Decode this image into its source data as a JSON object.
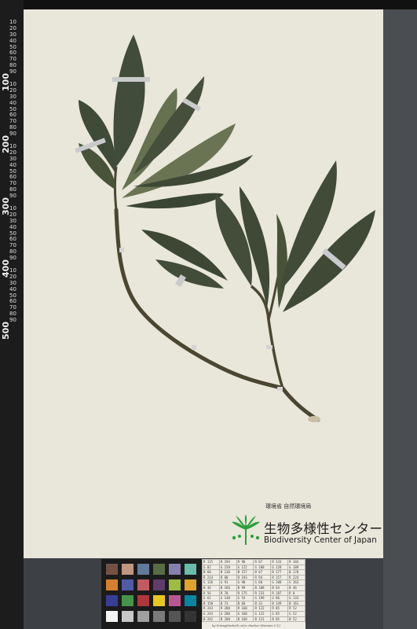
{
  "header_logo": {
    "ministry_text": "環境省 自然環境局",
    "center_name_jp": "生物多様性センター",
    "center_name_en": "Biodiversity Center of Japan"
  },
  "ruler": {
    "major_labels": [
      "100",
      "200",
      "300",
      "400",
      "500"
    ],
    "minor_labels": [
      "10",
      "20",
      "30",
      "40",
      "50",
      "60",
      "70",
      "80",
      "90",
      "10",
      "20",
      "30",
      "40",
      "50",
      "60",
      "70",
      "80",
      "90",
      "10",
      "20",
      "30",
      "40",
      "50",
      "60",
      "70",
      "80",
      "90",
      "10",
      "20",
      "30",
      "40",
      "50",
      "60",
      "70",
      "80",
      "90",
      "10",
      "20",
      "30",
      "40",
      "50",
      "60",
      "70",
      "80",
      "90"
    ]
  },
  "color_table": {
    "rows": [
      [
        "R 115",
        "R 194",
        "R 98",
        "R 87",
        "R 133",
        "R 103"
      ],
      [
        "G 82",
        "G 150",
        "G 122",
        "G 108",
        "G 128",
        "G 189"
      ],
      [
        "B 68",
        "B 130",
        "B 157",
        "B 67",
        "B 177",
        "B 170"
      ],
      [
        "R 214",
        "R 80",
        "R 193",
        "R 94",
        "R 157",
        "R 224"
      ],
      [
        "G 126",
        "G 91",
        "G 90",
        "G 60",
        "G 188",
        "G 163"
      ],
      [
        "B 44",
        "B 166",
        "B 99",
        "B 108",
        "B 64",
        "B 46"
      ],
      [
        "R 56",
        "R 70",
        "R 175",
        "R 231",
        "R 187",
        "R 8"
      ],
      [
        "G 61",
        "G 148",
        "G 54",
        "G 199",
        "G 86",
        "G 133"
      ],
      [
        "B 150",
        "B 73",
        "B 60",
        "B 31",
        "B 149",
        "B 161"
      ],
      [
        "R 243",
        "R 200",
        "R 160",
        "R 122",
        "R 85",
        "R 52"
      ],
      [
        "G 243",
        "G 200",
        "G 160",
        "G 122",
        "G 85",
        "G 52"
      ],
      [
        "B 242",
        "B 200",
        "B 160",
        "B 121",
        "B 85",
        "B 52"
      ]
    ],
    "credit": "by GretagMacbeth color checker  (Harmon C.V.)"
  },
  "swatch_colors": [
    "#735244",
    "#c29682",
    "#627a9d",
    "#576c43",
    "#8580b1",
    "#67bdaa",
    "#d67e2c",
    "#505ba6",
    "#c15a63",
    "#5e3c6c",
    "#9dbc40",
    "#e0a32e",
    "#383d96",
    "#469449",
    "#af363c",
    "#e7c71f",
    "#bb5695",
    "#0885a1",
    "#f3f3f2",
    "#c8c8c8",
    "#a0a0a0",
    "#7a7a79",
    "#555555",
    "#343434"
  ]
}
